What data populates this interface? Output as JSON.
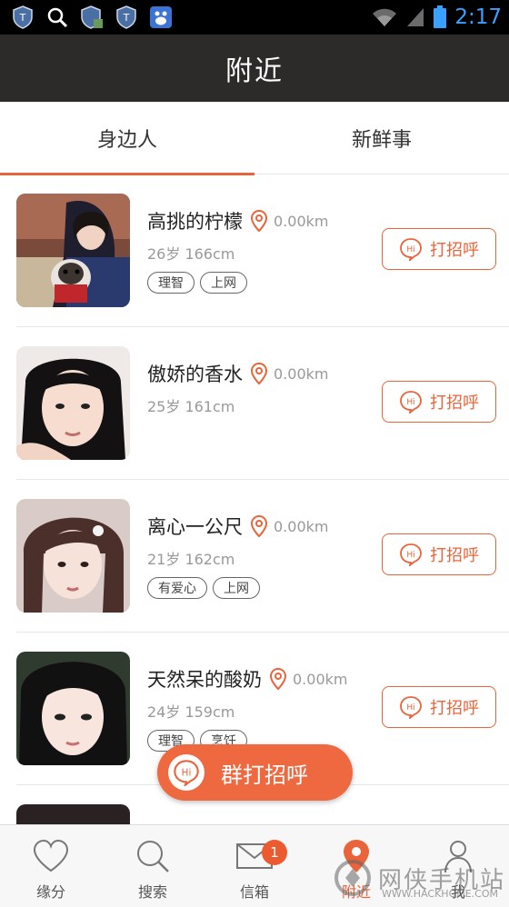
{
  "status_bar": {
    "time": "2:17"
  },
  "header": {
    "title": "附近"
  },
  "tabs": [
    {
      "label": "身边人",
      "active": true
    },
    {
      "label": "新鲜事",
      "active": false
    }
  ],
  "users": [
    {
      "name": "高挑的柠檬",
      "distance": "0.00km",
      "meta": "26岁 166cm",
      "tags": [
        "理智",
        "上网"
      ],
      "greet_label": "打招呼"
    },
    {
      "name": "傲娇的香水",
      "distance": "0.00km",
      "meta": "25岁 161cm",
      "tags": [],
      "greet_label": "打招呼"
    },
    {
      "name": "离心一公尺",
      "distance": "0.00km",
      "meta": "21岁 162cm",
      "tags": [
        "有爱心",
        "上网"
      ],
      "greet_label": "打招呼"
    },
    {
      "name": "天然呆的酸奶",
      "distance": "0.00km",
      "meta": "24岁 159cm",
      "tags": [
        "理智",
        "烹饪"
      ],
      "greet_label": "打招呼"
    }
  ],
  "greet_hi": "Hi",
  "group_greet": {
    "label": "群打招呼"
  },
  "bottom_nav": [
    {
      "label": "缘分",
      "icon": "heart-icon"
    },
    {
      "label": "搜索",
      "icon": "search-icon"
    },
    {
      "label": "信箱",
      "icon": "mail-icon",
      "badge": "1"
    },
    {
      "label": "附近",
      "icon": "location-icon",
      "active": true
    },
    {
      "label": "我",
      "icon": "person-icon"
    }
  ],
  "watermark": {
    "cn": "网侠手机站",
    "en": "WWW.HACKHOME.COM"
  },
  "colors": {
    "accent": "#e9643a",
    "header_bg": "#2d2a2a",
    "status_time": "#3aa0ff"
  }
}
